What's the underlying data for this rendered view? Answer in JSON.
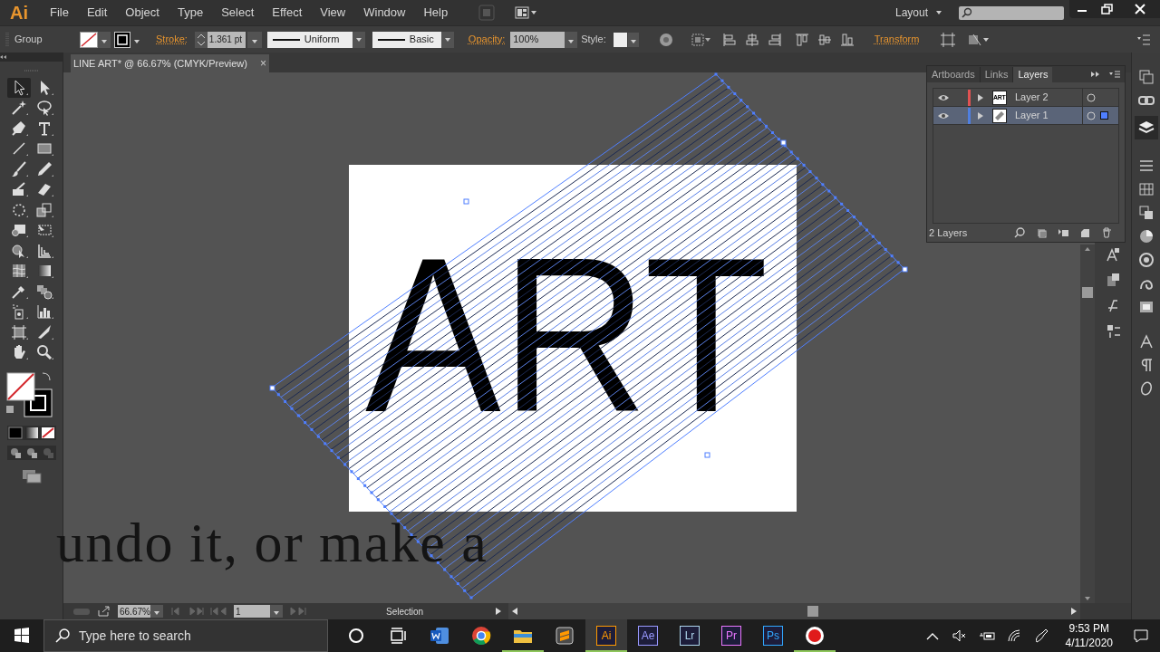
{
  "app": {
    "logo": "Ai"
  },
  "menu": [
    {
      "label": "File"
    },
    {
      "label": "Edit"
    },
    {
      "label": "Object"
    },
    {
      "label": "Type"
    },
    {
      "label": "Select"
    },
    {
      "label": "Effect"
    },
    {
      "label": "View"
    },
    {
      "label": "Window"
    },
    {
      "label": "Help"
    }
  ],
  "workspace": {
    "label": "Layout"
  },
  "control_bar": {
    "selection": "Group",
    "stroke_label": "Stroke:",
    "stroke_weight": "1.361 pt",
    "profile": "Uniform",
    "brush": "Basic",
    "opacity_label": "Opacity:",
    "opacity": "100%",
    "style_label": "Style:",
    "transform": "Transform"
  },
  "document_tab": {
    "title": "LINE ART* @ 66.67% (CMYK/Preview)",
    "close": "×"
  },
  "tools": [
    {
      "kind": "selection",
      "selected": true
    },
    {
      "kind": "direct-selection",
      "selected": false
    },
    {
      "kind": "magic-wand",
      "selected": false
    },
    {
      "kind": "lasso",
      "selected": false
    },
    {
      "kind": "pen",
      "selected": false
    },
    {
      "kind": "type",
      "selected": false
    },
    {
      "kind": "line",
      "selected": false
    },
    {
      "kind": "rectangle",
      "selected": false
    },
    {
      "kind": "paintbrush",
      "selected": false
    },
    {
      "kind": "pencil",
      "selected": false
    },
    {
      "kind": "shaper",
      "selected": false
    },
    {
      "kind": "eraser",
      "selected": false
    },
    {
      "kind": "rotate",
      "selected": false
    },
    {
      "kind": "scale",
      "selected": false
    },
    {
      "kind": "warp",
      "selected": false
    },
    {
      "kind": "free-transform",
      "selected": false
    },
    {
      "kind": "shape-builder",
      "selected": false
    },
    {
      "kind": "perspective",
      "selected": false
    },
    {
      "kind": "mesh",
      "selected": false
    },
    {
      "kind": "gradient",
      "selected": false
    },
    {
      "kind": "eyedropper",
      "selected": false
    },
    {
      "kind": "blend",
      "selected": false
    },
    {
      "kind": "symbol-sprayer",
      "selected": false
    },
    {
      "kind": "graph",
      "selected": false
    },
    {
      "kind": "artboard",
      "selected": false
    },
    {
      "kind": "slice",
      "selected": false
    },
    {
      "kind": "hand",
      "selected": false
    },
    {
      "kind": "zoom",
      "selected": false
    }
  ],
  "artboard": {
    "text": "ART"
  },
  "caption": "undo it, or make a",
  "layers_panel": {
    "tabs": [
      {
        "label": "Artboards",
        "selected": false
      },
      {
        "label": "Links",
        "selected": false
      },
      {
        "label": "Layers",
        "selected": true
      }
    ],
    "layers": [
      {
        "name": "Layer 2",
        "color": "#e05252",
        "visible": true,
        "selected": false,
        "has_selection": false,
        "thumbnail": {
          "kind": "text",
          "text": "ART"
        }
      },
      {
        "name": "Layer 1",
        "color": "#4f7fe0",
        "visible": true,
        "selected": true,
        "has_selection": true,
        "thumbnail": {
          "kind": "shape"
        }
      }
    ],
    "footer": "2 Layers"
  },
  "status_bar": {
    "zoom": "66.67%",
    "artboard": "1",
    "tool": "Selection"
  },
  "taskbar": {
    "search_placeholder": "Type here to search",
    "apps": [
      {
        "kind": "cortana",
        "selected": false,
        "running": false
      },
      {
        "kind": "task-view",
        "selected": false,
        "running": false
      },
      {
        "kind": "word",
        "selected": false,
        "running": false
      },
      {
        "kind": "chrome",
        "selected": false,
        "running": false
      },
      {
        "kind": "folder",
        "selected": false,
        "running": true
      },
      {
        "kind": "sublime",
        "selected": false,
        "running": false
      },
      {
        "kind": "adobe",
        "label": "Ai",
        "color": "#ff9a00",
        "selected": true,
        "running": true
      },
      {
        "kind": "adobe",
        "label": "Ae",
        "color": "#9999ff",
        "selected": false,
        "running": false
      },
      {
        "kind": "adobe",
        "label": "Lr",
        "color": "#add5ec",
        "selected": false,
        "running": false
      },
      {
        "kind": "adobe",
        "label": "Pr",
        "color": "#ea77ff",
        "selected": false,
        "running": false
      },
      {
        "kind": "adobe",
        "label": "Ps",
        "color": "#31a8ff",
        "selected": false,
        "running": false
      },
      {
        "kind": "record",
        "selected": false,
        "running": true
      }
    ],
    "time": "9:53 PM",
    "date": "4/11/2020"
  }
}
